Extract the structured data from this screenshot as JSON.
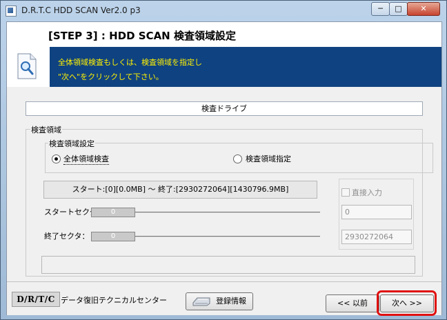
{
  "window": {
    "title": "D.R.T.C HDD SCAN Ver2.0 p3",
    "controls": {
      "minimize": "─",
      "maximize": "□",
      "close": "✕"
    }
  },
  "header": {
    "step_title": "[STEP 3] : HDD SCAN  検査領域設定",
    "info_lines": [
      "全体領域検査もしくは、検査領域を指定し",
      "\"次へ\"をクリックして下さい。"
    ]
  },
  "drive": {
    "label": "検査ドライブ"
  },
  "scan_area": {
    "group_label": "検査領域",
    "settings_label": "検査領域設定",
    "options": [
      {
        "label": "全体領域検査",
        "selected": true
      },
      {
        "label": "検査領域指定",
        "selected": false
      }
    ],
    "range_text": "スタート:[0][0.0MB] ～ 終了:[2930272064][1430796.9MB]",
    "direct_input": {
      "label": "直接入力",
      "checked": false
    },
    "start_sector": {
      "label": "スタートセクタ：",
      "thumb_text": "0",
      "input_value": "0"
    },
    "end_sector": {
      "label": "終了セクタ：",
      "thumb_text": "0",
      "input_value": "2930272064"
    }
  },
  "footer": {
    "logo_text": "D/R/T/C",
    "company_name": "データ復旧テクニカルセンター",
    "register_button": "登録情報",
    "prev_button": "<< 以前",
    "next_button": "次へ >>"
  },
  "icons": {
    "app": "app-icon",
    "document_search": "document-search-icon",
    "scanner": "scanner-icon"
  },
  "colors": {
    "header_band": "#0f4280",
    "instruction_text": "#fff200",
    "highlight": "#e01010"
  }
}
